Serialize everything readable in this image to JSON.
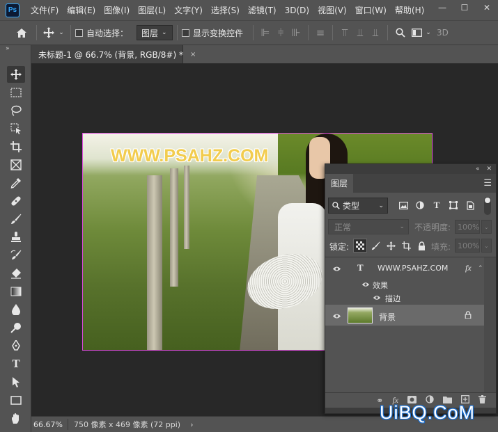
{
  "app": {
    "logo_text": "Ps"
  },
  "menu": [
    {
      "label": "文件(F)"
    },
    {
      "label": "编辑(E)"
    },
    {
      "label": "图像(I)"
    },
    {
      "label": "图层(L)"
    },
    {
      "label": "文字(Y)"
    },
    {
      "label": "选择(S)"
    },
    {
      "label": "滤镜(T)"
    },
    {
      "label": "3D(D)"
    },
    {
      "label": "视图(V)"
    },
    {
      "label": "窗口(W)"
    },
    {
      "label": "帮助(H)"
    }
  ],
  "window_controls": {
    "minimize": "—",
    "maximize": "☐",
    "close": "✕"
  },
  "options_bar": {
    "auto_select_label": "自动选择：",
    "auto_select_value": "图层",
    "show_transform_label": "显示变换控件",
    "overflow_text": "3D"
  },
  "document": {
    "tab_title": "未标题-1 @ 66.7% (背景, RGB/8#) *",
    "tab_close": "×",
    "watermark_text": "WWW.PSAHZ.COM"
  },
  "status_bar": {
    "zoom": "66.67%",
    "doc_size": "750 像素 x 469 像素 (72 ppi)",
    "arrow": "›"
  },
  "layers_panel": {
    "tab_label": "图层",
    "filter_label": "类型",
    "blend_mode": "正常",
    "opacity_label": "不透明度:",
    "opacity_value": "100%",
    "lock_label": "锁定:",
    "fill_label": "填充:",
    "fill_value": "100%",
    "layers": [
      {
        "type_glyph": "T",
        "name": "WWW.PSAHZ.COM",
        "fx": "fx",
        "effects_label": "效果",
        "stroke_label": "描边"
      },
      {
        "name": "背景"
      }
    ]
  },
  "corner_watermark": "UiBQ.CoM"
}
